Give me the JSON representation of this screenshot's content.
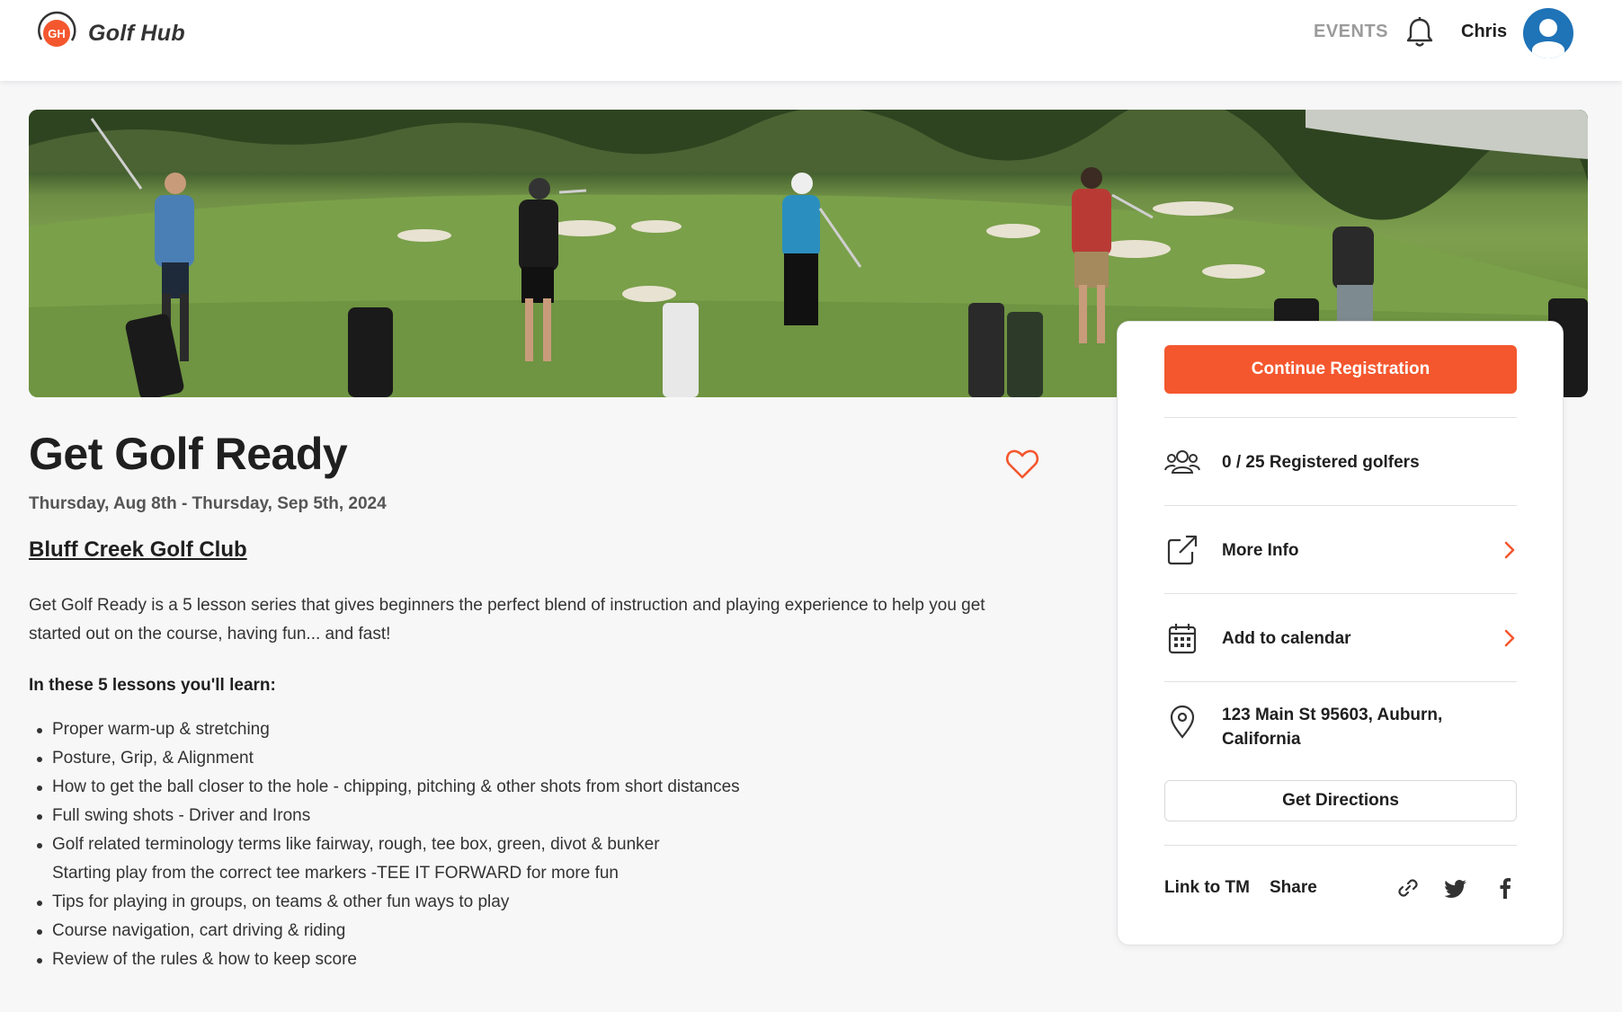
{
  "app": {
    "logo_badge": "GH",
    "name": "Golf Hub",
    "brand_color": "#f4572e"
  },
  "header": {
    "nav_events": "EVENTS",
    "user_name": "Chris",
    "icons": [
      "bell-icon",
      "avatar-icon"
    ]
  },
  "event": {
    "title": "Get Golf Ready",
    "dates": "Thursday, Aug 8th - Thursday, Sep 5th, 2024",
    "club": "Bluff Creek Golf Club",
    "description": "Get Golf Ready is a 5 lesson series that gives beginners the perfect blend of instruction and playing experience to help you get started out on the course, having fun... and fast!",
    "learn_heading": "In these 5 lessons you'll learn:",
    "lessons": [
      "Proper warm-up & stretching",
      "Posture, Grip, & Alignment",
      "How to get the ball closer to the hole - chipping, pitching & other shots from short distances",
      "Full swing shots - Driver and Irons",
      "Golf related terminology terms like fairway, rough, tee box, green, divot & bunker",
      "Starting play from the correct tee markers -TEE IT FORWARD for more fun",
      "Tips for playing in groups, on teams & other fun ways to play",
      "Course navigation, cart driving & riding",
      "Review of the rules & how to keep score"
    ]
  },
  "card": {
    "cta_label": "Continue Registration",
    "registered": "0 / 25 Registered golfers",
    "more_info": "More Info",
    "add_calendar": "Add to calendar",
    "address": "123 Main St 95603, Auburn, California",
    "directions": "Get Directions",
    "link_tm": "Link to TM",
    "share": "Share",
    "share_icons": [
      "link-icon",
      "twitter-icon",
      "facebook-icon"
    ]
  }
}
